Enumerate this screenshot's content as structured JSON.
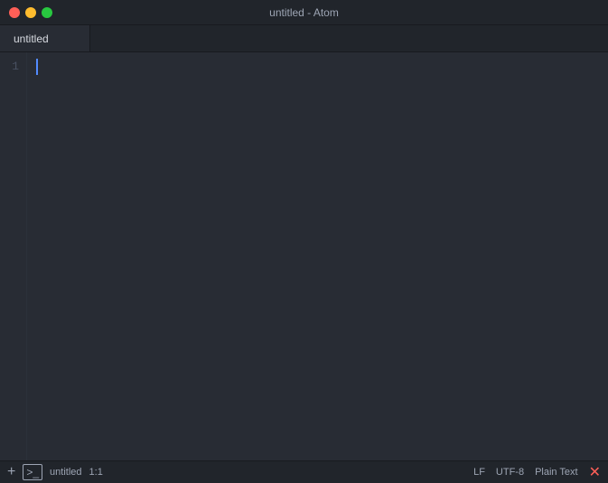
{
  "titleBar": {
    "title": "untitled - Atom",
    "trafficLights": {
      "close": "close",
      "minimize": "minimize",
      "maximize": "maximize"
    }
  },
  "tabBar": {
    "activeTab": {
      "label": "untitled"
    }
  },
  "editor": {
    "lineNumbers": [
      "1"
    ],
    "content": ""
  },
  "statusBar": {
    "left": {
      "fileName": "untitled",
      "position": "1:1",
      "addButtonLabel": "+",
      "terminalButtonLabel": ">_"
    },
    "right": {
      "lineEnding": "LF",
      "encoding": "UTF-8",
      "grammar": "Plain Text",
      "errorIcon": "✕"
    }
  }
}
